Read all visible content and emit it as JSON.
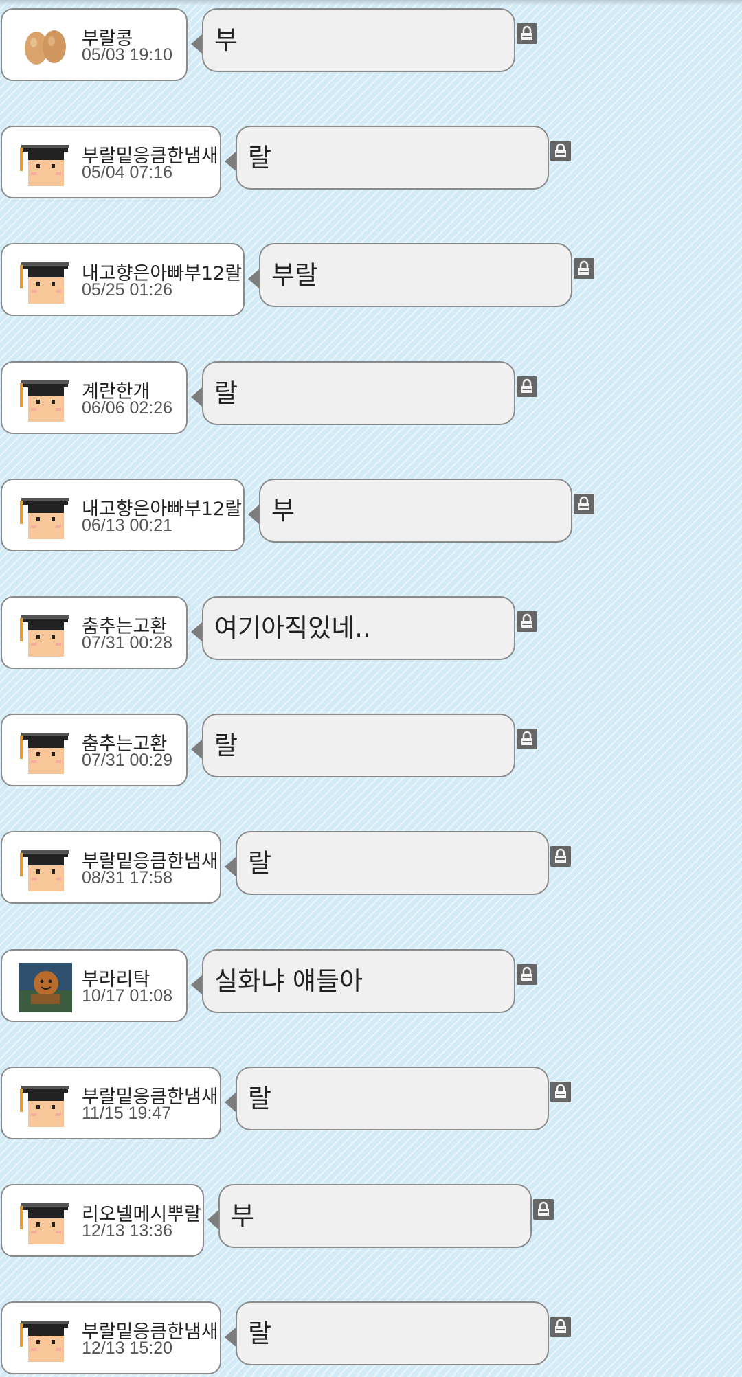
{
  "messages": [
    {
      "name": "부랄콩",
      "time": "05/03 19:10",
      "text": "부",
      "avatar": "peanut-avatar"
    },
    {
      "name": "부랄밑응큼한냄새",
      "time": "05/04 07:16",
      "text": "랄",
      "avatar": "graduate-avatar"
    },
    {
      "name": "내고향은아빠부12랄",
      "time": "05/25 01:26",
      "text": "부랄",
      "avatar": "graduate-avatar"
    },
    {
      "name": "계란한개",
      "time": "06/06 02:26",
      "text": "랄",
      "avatar": "graduate-avatar"
    },
    {
      "name": "내고향은아빠부12랄",
      "time": "06/13 00:21",
      "text": "부",
      "avatar": "graduate-avatar"
    },
    {
      "name": "춤추는고환",
      "time": "07/31 00:28",
      "text": "여기아직있네..",
      "avatar": "graduate-avatar"
    },
    {
      "name": "춤추는고환",
      "time": "07/31 00:29",
      "text": "랄",
      "avatar": "graduate-avatar"
    },
    {
      "name": "부랄밑응큼한냄새",
      "time": "08/31 17:58",
      "text": "랄",
      "avatar": "graduate-avatar"
    },
    {
      "name": "부라리탁",
      "time": "10/17 01:08",
      "text": "실화냐 얘들아",
      "avatar": "cookie-avatar"
    },
    {
      "name": "부랄밑응큼한냄새",
      "time": "11/15 19:47",
      "text": "랄",
      "avatar": "graduate-avatar"
    },
    {
      "name": "리오넬메시뿌랄",
      "time": "12/13 13:36",
      "text": "부",
      "avatar": "graduate-avatar"
    },
    {
      "name": "부랄밑응큼한냄새",
      "time": "12/13 15:20",
      "text": "랄",
      "avatar": "graduate-avatar"
    }
  ],
  "icons": {
    "lock": "lock-icon"
  },
  "colors": {
    "background": "#d3ebf6",
    "bubble": "#f0f0f0",
    "border": "#8a8a8a"
  }
}
